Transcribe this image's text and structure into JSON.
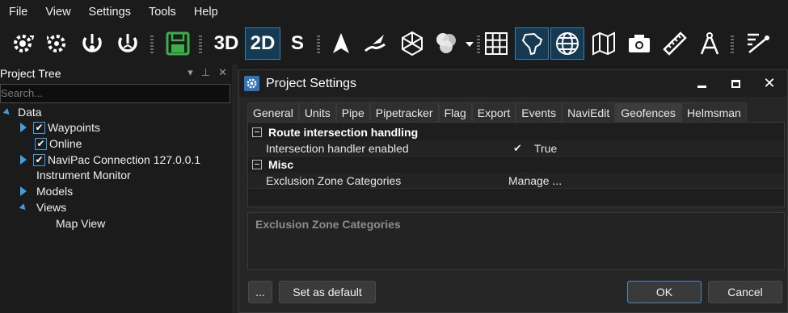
{
  "menu": [
    "File",
    "View",
    "Settings",
    "Tools",
    "Help"
  ],
  "toolbar": {
    "btn_3d": "3D",
    "btn_2d": "2D",
    "btn_s": "S",
    "accent": "#3aa0e6",
    "save_color": "#3ab04a"
  },
  "tree": {
    "title": "Project Tree",
    "search_placeholder": "Search...",
    "items": [
      {
        "label": "Data"
      },
      {
        "label": "Waypoints"
      },
      {
        "label": "Online"
      },
      {
        "label": "NaviPac Connection 127.0.0.1"
      },
      {
        "label": "Instrument Monitor"
      },
      {
        "label": "Models"
      },
      {
        "label": "Views"
      },
      {
        "label": "Map View"
      }
    ]
  },
  "dialog": {
    "title": "Project Settings",
    "tabs": [
      "General",
      "Units",
      "Pipe",
      "Pipetracker",
      "Flag",
      "Export",
      "Events",
      "NaviEdit",
      "Geofences",
      "Helmsman"
    ],
    "selected_tab": "Geofences",
    "sections": [
      {
        "name": "Route intersection handling",
        "props": [
          {
            "name": "Intersection handler enabled",
            "value": "True",
            "checked": true
          }
        ]
      },
      {
        "name": "Misc",
        "props": [
          {
            "name": "Exclusion Zone Categories",
            "value": "Manage ..."
          }
        ]
      }
    ],
    "description_title": "Exclusion Zone Categories",
    "buttons": {
      "more": "...",
      "set_default": "Set as default",
      "ok": "OK",
      "cancel": "Cancel"
    }
  }
}
